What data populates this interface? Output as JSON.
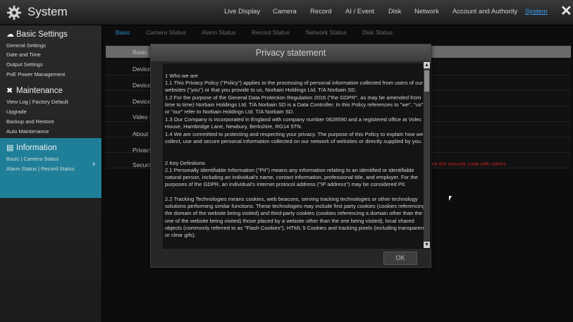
{
  "app": {
    "title": "System",
    "close_icon": "close-icon"
  },
  "topnav": [
    {
      "label": "Live Display"
    },
    {
      "label": "Camera"
    },
    {
      "label": "Record"
    },
    {
      "label": "AI / Event"
    },
    {
      "label": "Disk"
    },
    {
      "label": "Network"
    },
    {
      "label": "Account and Authority"
    },
    {
      "label": "System"
    }
  ],
  "sidebar": {
    "basic": {
      "label": "Basic Settings",
      "items": [
        "General Settings",
        "Date and Time",
        "Output Settings",
        "PoE Power Management"
      ]
    },
    "maintenance": {
      "label": "Maintenance",
      "items": [
        "View Log | Factory Default",
        "Upgrade",
        "Backup and Restore",
        "Auto Maintenance"
      ]
    },
    "information": {
      "label": "Information",
      "items": [
        "Basic | Camera Status",
        "Alarm Status | Record Status"
      ]
    }
  },
  "tabs": [
    "Basic",
    "Camera Status",
    "Alarm Status",
    "Record Status",
    "Network Status",
    "Disk Status"
  ],
  "rows": [
    "Basic",
    "Device",
    "Device",
    "Device",
    "Video I",
    "About I",
    "Privacy",
    "Securit"
  ],
  "security_warning": "are the security code with others",
  "modal": {
    "title": "Privacy statement",
    "paragraphs": [
      "1 Who we are",
      "1.1 This Privacy Policy (\"Policy\") applies to the processing of personal information collected from users of our websites (\"you\") or that you provide to us, Norbain Holdings Ltd. T/A Norbain SD.",
      "1.2 For the purpose of the General Data Protection Regulation 2016 (\"the GDPR\", as may be amended from time to time) Norbain Holdings Ltd. T/A Norbain SD is a Data Controller. In this Policy references to \"we\", \"us\" or \"our\" refer to Norbain Holdings Ltd. T/A Norbain SD.",
      "1.3 Our Company is incorporated in England with company number 0628590 and a registered office at Volec House, Hambridge Lane, Newbury, Berkshire, RG14 5TN.",
      "1.4 We are committed to protecting and respecting your privacy. The purpose of this Policy to explain how we collect, use and secure personal information collected on our network of websites or directly supplied by you.",
      "",
      "2 Key Definitions",
      "2.1 Personally Identifiable Information (\"PII\") means any information relating to an identified or identifiable natural person, including an individual's name, contact information, professional title, and employer. For the purposes of the GDPR, an individual's internet protocol address (\"IP address\") may be considered PII.",
      "2.2 Tracking Technologies means cookies, web beacons, serving tracking technologies or other technology solutions performing similar functions. These technologies may include first party cookies (cookies referencing the domain of the website being visited) and third-party cookies (cookies referencing a domain other than the one of the website being visited) those placed by a website other than the one being visited), local shared objects (commonly referred to as \"Flash Cookies\"), HTML 5 Cookies and tracking pixels (including transparent or clear gifs)."
    ],
    "ok_label": "OK"
  }
}
